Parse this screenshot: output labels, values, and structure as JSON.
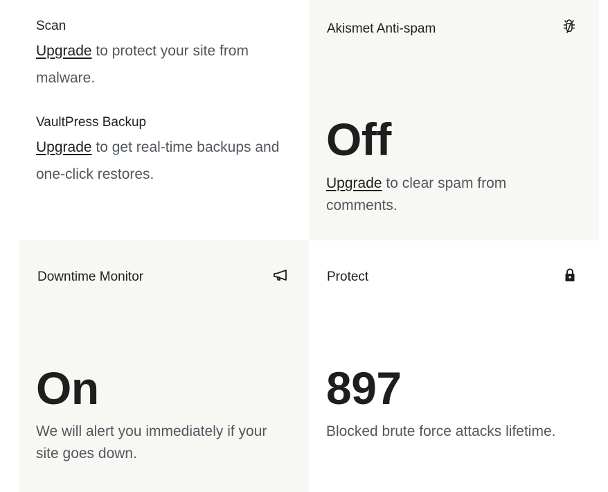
{
  "scan": {
    "title": "Scan",
    "link": "Upgrade",
    "text": " to protect your site from malware."
  },
  "vaultpress": {
    "title": "VaultPress Backup",
    "link": "Upgrade",
    "text": " to get real-time backups and one-click restores."
  },
  "akismet": {
    "title": "Akismet Anti-spam",
    "icon": "bug-off-icon",
    "value": "Off",
    "link": "Upgrade",
    "text": " to clear spam from comments."
  },
  "downtime": {
    "title": "Downtime Monitor",
    "icon": "megaphone-icon",
    "value": "On",
    "text": "We will alert you immediately if your site goes down."
  },
  "protect": {
    "title": "Protect",
    "icon": "lock-icon",
    "value": "897",
    "text": "Blocked brute force attacks lifetime."
  },
  "colors": {
    "panel_background": "#f7f7f3",
    "text_primary": "#1e1e1e",
    "text_secondary": "#50575e"
  }
}
